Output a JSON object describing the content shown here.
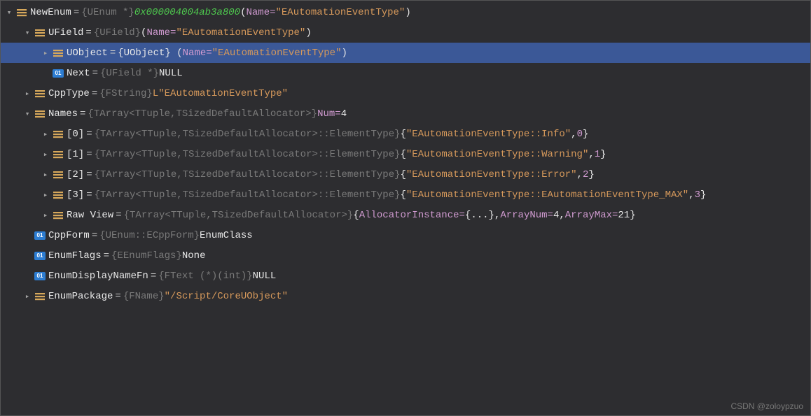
{
  "watermark": "CSDN @zoloypzuo",
  "icon01": "01",
  "rows": [
    {
      "indent": 0,
      "chev": "down",
      "icon": "enum",
      "selected": false,
      "parts": [
        {
          "t": "NewEnum",
          "c": "white"
        },
        {
          "t": " = ",
          "c": "eq"
        },
        {
          "t": "{UEnum *} ",
          "c": "gray"
        },
        {
          "t": "0x000004004ab3a800",
          "c": "green"
        },
        {
          "t": " (",
          "c": "white"
        },
        {
          "t": "Name=",
          "c": "pink"
        },
        {
          "t": "\"EAutomationEventType\"",
          "c": "brown"
        },
        {
          "t": ")",
          "c": "white"
        }
      ]
    },
    {
      "indent": 1,
      "chev": "down",
      "icon": "enum",
      "selected": false,
      "parts": [
        {
          "t": "UField",
          "c": "white"
        },
        {
          "t": " = ",
          "c": "eq"
        },
        {
          "t": "{UField} ",
          "c": "gray"
        },
        {
          "t": "(",
          "c": "white"
        },
        {
          "t": "Name=",
          "c": "pink"
        },
        {
          "t": "\"EAutomationEventType\"",
          "c": "brown"
        },
        {
          "t": ")",
          "c": "white"
        }
      ]
    },
    {
      "indent": 2,
      "chev": "right",
      "icon": "enum",
      "selected": true,
      "parts": [
        {
          "t": "UObject",
          "c": "white"
        },
        {
          "t": " = ",
          "c": "eq"
        },
        {
          "t": "{UObject} (",
          "c": "white"
        },
        {
          "t": "Name=",
          "c": "pink"
        },
        {
          "t": "\"EAutomationEventType\"",
          "c": "brown"
        },
        {
          "t": ")",
          "c": "white"
        }
      ]
    },
    {
      "indent": 2,
      "chev": "none",
      "icon": "01",
      "selected": false,
      "parts": [
        {
          "t": "Next",
          "c": "white"
        },
        {
          "t": " = ",
          "c": "eq"
        },
        {
          "t": "{UField *} ",
          "c": "gray"
        },
        {
          "t": "NULL",
          "c": "white"
        }
      ]
    },
    {
      "indent": 1,
      "chev": "right",
      "icon": "enum",
      "selected": false,
      "parts": [
        {
          "t": "CppType",
          "c": "white"
        },
        {
          "t": " = ",
          "c": "eq"
        },
        {
          "t": "{FString} ",
          "c": "gray"
        },
        {
          "t": "L\"EAutomationEventType\"",
          "c": "brown"
        }
      ]
    },
    {
      "indent": 1,
      "chev": "down",
      "icon": "enum",
      "selected": false,
      "parts": [
        {
          "t": "Names",
          "c": "white"
        },
        {
          "t": " = ",
          "c": "eq"
        },
        {
          "t": "{TArray<TTuple,TSizedDefaultAllocator>} ",
          "c": "gray"
        },
        {
          "t": "Num=",
          "c": "pink"
        },
        {
          "t": "4",
          "c": "white"
        }
      ]
    },
    {
      "indent": 2,
      "chev": "right",
      "icon": "enum",
      "selected": false,
      "parts": [
        {
          "t": "[0]",
          "c": "white"
        },
        {
          "t": " = ",
          "c": "eq"
        },
        {
          "t": "{TArray<TTuple,TSizedDefaultAllocator>::ElementType} ",
          "c": "gray"
        },
        {
          "t": "{",
          "c": "white"
        },
        {
          "t": "\"EAutomationEventType::Info\"",
          "c": "brown"
        },
        {
          "t": ",",
          "c": "white"
        },
        {
          "t": "0",
          "c": "pink"
        },
        {
          "t": "}",
          "c": "white"
        }
      ]
    },
    {
      "indent": 2,
      "chev": "right",
      "icon": "enum",
      "selected": false,
      "parts": [
        {
          "t": "[1]",
          "c": "white"
        },
        {
          "t": " = ",
          "c": "eq"
        },
        {
          "t": "{TArray<TTuple,TSizedDefaultAllocator>::ElementType} ",
          "c": "gray"
        },
        {
          "t": "{",
          "c": "white"
        },
        {
          "t": "\"EAutomationEventType::Warning\"",
          "c": "brown"
        },
        {
          "t": ",",
          "c": "white"
        },
        {
          "t": "1",
          "c": "pink"
        },
        {
          "t": "}",
          "c": "white"
        }
      ]
    },
    {
      "indent": 2,
      "chev": "right",
      "icon": "enum",
      "selected": false,
      "parts": [
        {
          "t": "[2]",
          "c": "white"
        },
        {
          "t": " = ",
          "c": "eq"
        },
        {
          "t": "{TArray<TTuple,TSizedDefaultAllocator>::ElementType} ",
          "c": "gray"
        },
        {
          "t": "{",
          "c": "white"
        },
        {
          "t": "\"EAutomationEventType::Error\"",
          "c": "brown"
        },
        {
          "t": ",",
          "c": "white"
        },
        {
          "t": "2",
          "c": "pink"
        },
        {
          "t": "}",
          "c": "white"
        }
      ]
    },
    {
      "indent": 2,
      "chev": "right",
      "icon": "enum",
      "selected": false,
      "parts": [
        {
          "t": "[3]",
          "c": "white"
        },
        {
          "t": " = ",
          "c": "eq"
        },
        {
          "t": "{TArray<TTuple,TSizedDefaultAllocator>::ElementType} ",
          "c": "gray"
        },
        {
          "t": "{",
          "c": "white"
        },
        {
          "t": "\"EAutomationEventType::EAutomationEventType_MAX\"",
          "c": "brown"
        },
        {
          "t": ",",
          "c": "white"
        },
        {
          "t": "3",
          "c": "pink"
        },
        {
          "t": "}",
          "c": "white"
        }
      ]
    },
    {
      "indent": 2,
      "chev": "right",
      "icon": "enum",
      "selected": false,
      "parts": [
        {
          "t": "Raw View",
          "c": "white"
        },
        {
          "t": " = ",
          "c": "eq"
        },
        {
          "t": "{TArray<TTuple,TSizedDefaultAllocator>} ",
          "c": "gray"
        },
        {
          "t": "{",
          "c": "white"
        },
        {
          "t": "AllocatorInstance=",
          "c": "pink"
        },
        {
          "t": "{...}, ",
          "c": "white"
        },
        {
          "t": "ArrayNum=",
          "c": "pink"
        },
        {
          "t": "4",
          "c": "white"
        },
        {
          "t": ", ",
          "c": "white"
        },
        {
          "t": "ArrayMax=",
          "c": "pink"
        },
        {
          "t": "21",
          "c": "white"
        },
        {
          "t": "}",
          "c": "white"
        }
      ]
    },
    {
      "indent": 1,
      "chev": "none",
      "icon": "01",
      "selected": false,
      "parts": [
        {
          "t": "CppForm",
          "c": "white"
        },
        {
          "t": " = ",
          "c": "eq"
        },
        {
          "t": "{UEnum::ECppForm} ",
          "c": "gray"
        },
        {
          "t": "EnumClass",
          "c": "white"
        }
      ]
    },
    {
      "indent": 1,
      "chev": "none",
      "icon": "01",
      "selected": false,
      "parts": [
        {
          "t": "EnumFlags",
          "c": "white"
        },
        {
          "t": " = ",
          "c": "eq"
        },
        {
          "t": "{EEnumFlags} ",
          "c": "gray"
        },
        {
          "t": "None",
          "c": "white"
        }
      ]
    },
    {
      "indent": 1,
      "chev": "none",
      "icon": "01",
      "selected": false,
      "parts": [
        {
          "t": "EnumDisplayNameFn",
          "c": "white"
        },
        {
          "t": " = ",
          "c": "eq"
        },
        {
          "t": "{FText (*)(int)} ",
          "c": "gray"
        },
        {
          "t": "NULL",
          "c": "white"
        }
      ]
    },
    {
      "indent": 1,
      "chev": "right",
      "icon": "enum",
      "selected": false,
      "parts": [
        {
          "t": "EnumPackage",
          "c": "white"
        },
        {
          "t": " = ",
          "c": "eq"
        },
        {
          "t": "{FName} ",
          "c": "gray"
        },
        {
          "t": "\"/Script/CoreUObject\"",
          "c": "brown"
        }
      ]
    }
  ]
}
